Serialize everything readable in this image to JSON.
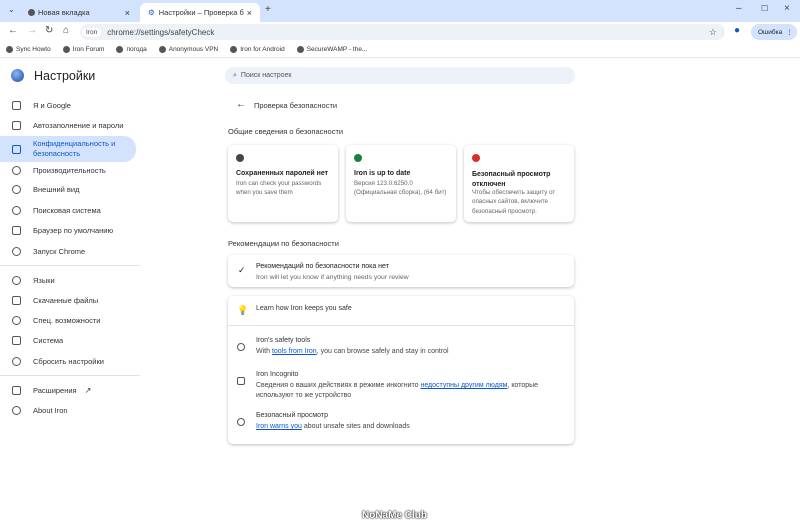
{
  "tabs": [
    {
      "label": "Новая вкладка"
    },
    {
      "label": "Настройки – Проверка безоп"
    }
  ],
  "address": {
    "chip": "Iron",
    "url": "chrome://settings/safetyCheck"
  },
  "profile": {
    "label": "Ошибка"
  },
  "bookmarks": [
    "Sync Howto",
    "Iron Forum",
    "погода",
    "Anonymous VPN",
    "Iron for Android",
    "SecureWAMP - the..."
  ],
  "header": {
    "title": "Настройки",
    "search_placeholder": "Поиск настроек"
  },
  "sidebar": {
    "items": [
      {
        "label": "Я и Google"
      },
      {
        "label": "Автозаполнение и пароли"
      },
      {
        "label": "Конфиденциальность и безопасность"
      },
      {
        "label": "Производительность"
      },
      {
        "label": "Внешний вид"
      },
      {
        "label": "Поисковая система"
      },
      {
        "label": "Браузер по умолчанию"
      },
      {
        "label": "Запуск Chrome"
      },
      {
        "label": "Языки"
      },
      {
        "label": "Скачанные файлы"
      },
      {
        "label": "Спец. возможности"
      },
      {
        "label": "Система"
      },
      {
        "label": "Сбросить настройки"
      },
      {
        "label": "Расширения"
      },
      {
        "label": "About Iron"
      }
    ]
  },
  "main": {
    "title": "Проверка безопасности",
    "overview_heading": "Общие сведения о безопасности",
    "cards": [
      {
        "title": "Сохраненных паролей нет",
        "desc": "Iron can check your passwords when you save them",
        "color": "#444746"
      },
      {
        "title": "Iron is up to date",
        "desc": "Версия 123.0.6250.0 (Официальная сборка), (64 бит)",
        "color": "#188038"
      },
      {
        "title": "Безопасный просмотр отключен",
        "desc": "Чтобы обеспечить защиту от опасных сайтов, включите безопасный просмотр.",
        "color": "#d93025"
      }
    ],
    "recs_heading": "Рекомендации по безопасности",
    "rec": {
      "title": "Рекомендаций по безопасности пока нет",
      "desc": "Iron will let you know if anything needs your review"
    },
    "learn": {
      "title": "Learn how Iron keeps you safe",
      "items": [
        {
          "title": "Iron's safety tools",
          "pre": "With ",
          "link": "tools from Iron",
          "post": ", you can browse safely and stay in control"
        },
        {
          "title": "Iron Incognito",
          "pre": "Сведения о ваших действиях в режиме инкогнито ",
          "link": "недоступны другим людям",
          "post": ", которые используют то же устройство"
        },
        {
          "title": "Безопасный просмотр",
          "pre": "",
          "link": "Iron warns you",
          "post": " about unsafe sites and downloads"
        }
      ]
    }
  },
  "watermark": "NoNaMe Club"
}
